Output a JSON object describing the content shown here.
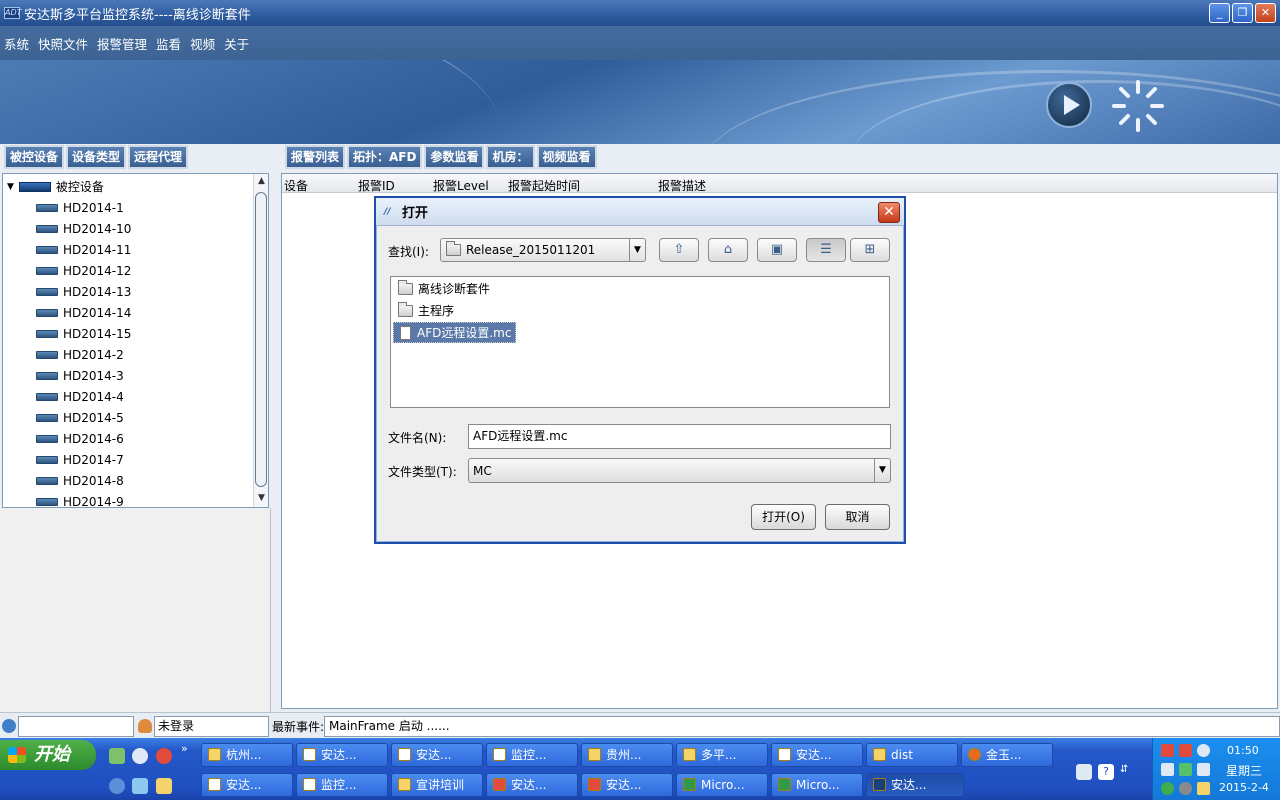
{
  "window": {
    "title": "安达斯多平台监控系统----离线诊断套件",
    "icon_text": "ADT"
  },
  "menu": [
    "系统",
    "快照文件",
    "报警管理",
    "监看",
    "视频",
    "关于"
  ],
  "left_tabs": [
    "被控设备",
    "设备类型",
    "远程代理"
  ],
  "tree": {
    "root": "被控设备",
    "items": [
      "HD2014-1",
      "HD2014-10",
      "HD2014-11",
      "HD2014-12",
      "HD2014-13",
      "HD2014-14",
      "HD2014-15",
      "HD2014-2",
      "HD2014-3",
      "HD2014-4",
      "HD2014-5",
      "HD2014-6",
      "HD2014-7",
      "HD2014-8",
      "HD2014-9"
    ]
  },
  "right_tabs": [
    "报警列表",
    "拓扑：AFD",
    "参数监看",
    "机房：",
    "视频监看"
  ],
  "alarm_table": {
    "columns": [
      "设备",
      "报警ID",
      "报警Level",
      "报警起始时间",
      "报警描述"
    ]
  },
  "dialog": {
    "title": "打开",
    "look_in_label": "查找(I):",
    "look_in_value": "Release_2015011201",
    "files": [
      {
        "name": "离线诊断套件",
        "type": "folder"
      },
      {
        "name": "主程序",
        "type": "folder"
      },
      {
        "name": "AFD远程设置.mc",
        "type": "file",
        "selected": true
      }
    ],
    "filename_label": "文件名(N):",
    "filename_value": "AFD远程设置.mc",
    "filetype_label": "文件类型(T):",
    "filetype_value": "MC",
    "open_button": "打开(O)",
    "cancel_button": "取消"
  },
  "status": {
    "user": "未登录",
    "event_label": "最新事件:",
    "event_value": "MainFrame 启动 ......"
  },
  "taskbar": {
    "start": "开始",
    "row1": [
      "杭州...",
      "安达...",
      "安达...",
      "监控...",
      "贵州...",
      "多平...",
      "安达...",
      "dist",
      "金玉..."
    ],
    "row2": [
      "安达...",
      "监控...",
      "宣讲培训",
      "安达...",
      "安达...",
      "Micro...",
      "Micro...",
      "安达..."
    ],
    "clock": "01:50",
    "weekday": "星期三",
    "date": "2015-2-4"
  },
  "colors": {
    "title_bar": "#2d5b9e",
    "menu_bar": "#3c6392",
    "taskbar": "#2458c8",
    "selection": "#5a78a8"
  }
}
